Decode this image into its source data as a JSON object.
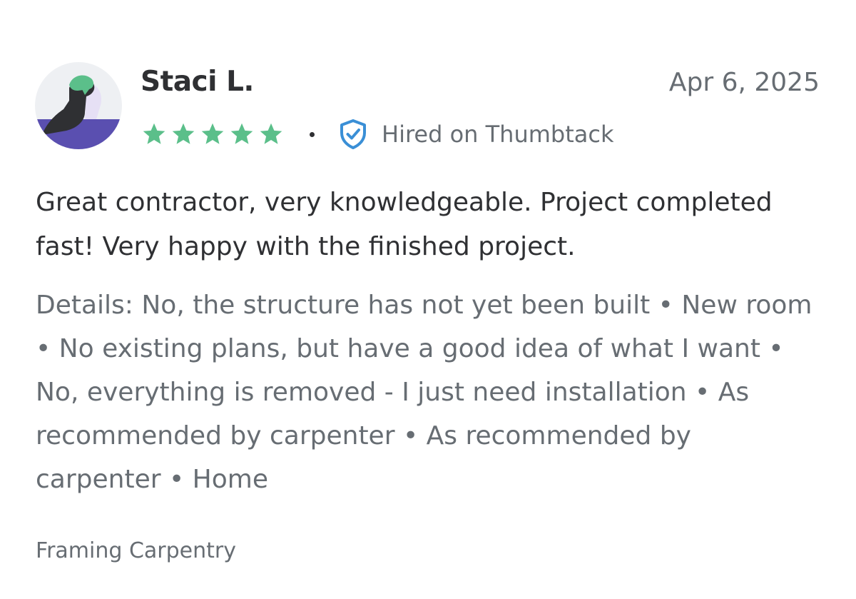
{
  "review": {
    "reviewer_name": "Staci L.",
    "date": "Apr 6, 2025",
    "rating": 5,
    "rating_max": 5,
    "star_color": "#5bbf8a",
    "hired_label": "Hired on Thumbtack",
    "hired_badge_color": "#3a8fd6",
    "body": "Great contractor, very knowledgeable. Project completed fast! Very happy with the finished project.",
    "details": "Details: No, the structure has not yet been built • New room • No existing plans, but have a good idea of what I want • No, everything is removed - I just need installation • As recommended by carpenter • As recommended by carpenter • Home",
    "category": "Framing Carpentry",
    "avatar_icon": "user-avatar-illustration",
    "badge_icon": "shield-check-icon",
    "star_icon": "star-icon"
  }
}
